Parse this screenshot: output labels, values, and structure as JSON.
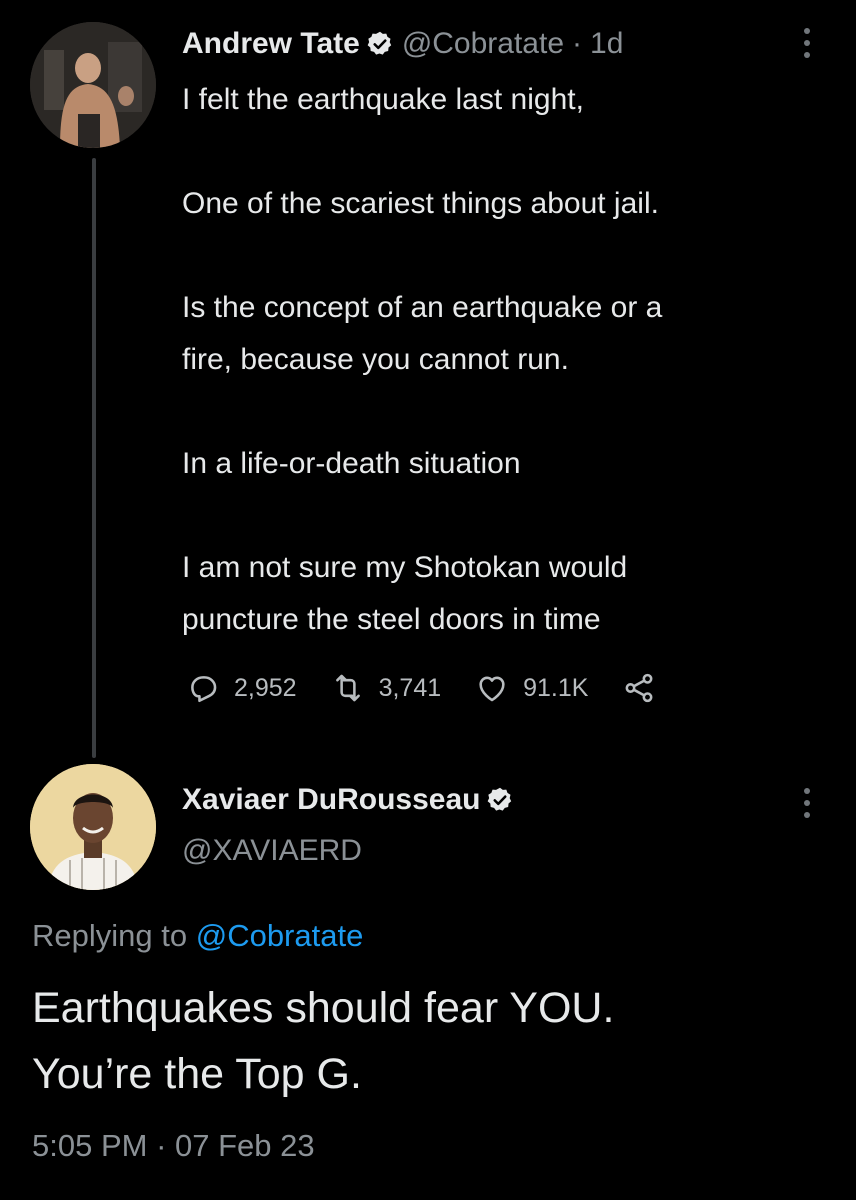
{
  "original_tweet": {
    "author_name": "Andrew Tate",
    "verified_icon": "verified-badge-icon",
    "handle": "@Cobratate",
    "separator": "·",
    "time_ago": "1d",
    "body_lines": [
      "I felt the earthquake last night,",
      "",
      "One of the scariest things about jail.",
      "",
      "Is the concept of an earthquake or a",
      "fire, because you cannot run.",
      "",
      "In a life-or-death situation",
      "",
      "I am not sure my Shotokan would",
      "puncture the steel doors in time"
    ],
    "actions": {
      "replies": "2,952",
      "retweets": "3,741",
      "likes": "91.1K"
    }
  },
  "reply_tweet": {
    "author_name": "Xaviaer DuRousseau",
    "handle": "@XAVIAERD",
    "replying_prefix": "Replying to",
    "replying_mention": "@Cobratate",
    "text_lines": [
      "Earthquakes should fear YOU.",
      "You’re the Top G."
    ],
    "timestamp": "5:05 PM",
    "separator": "·",
    "date": "07 Feb 23"
  },
  "colors": {
    "background": "#000000",
    "text_primary": "#e7e9ea",
    "text_secondary": "#8b9196",
    "link": "#1d9bf0",
    "thread_line": "#3a3d40"
  },
  "icons": [
    "reply-icon",
    "retweet-icon",
    "like-icon",
    "share-icon",
    "more-icon",
    "verified-badge-icon"
  ]
}
